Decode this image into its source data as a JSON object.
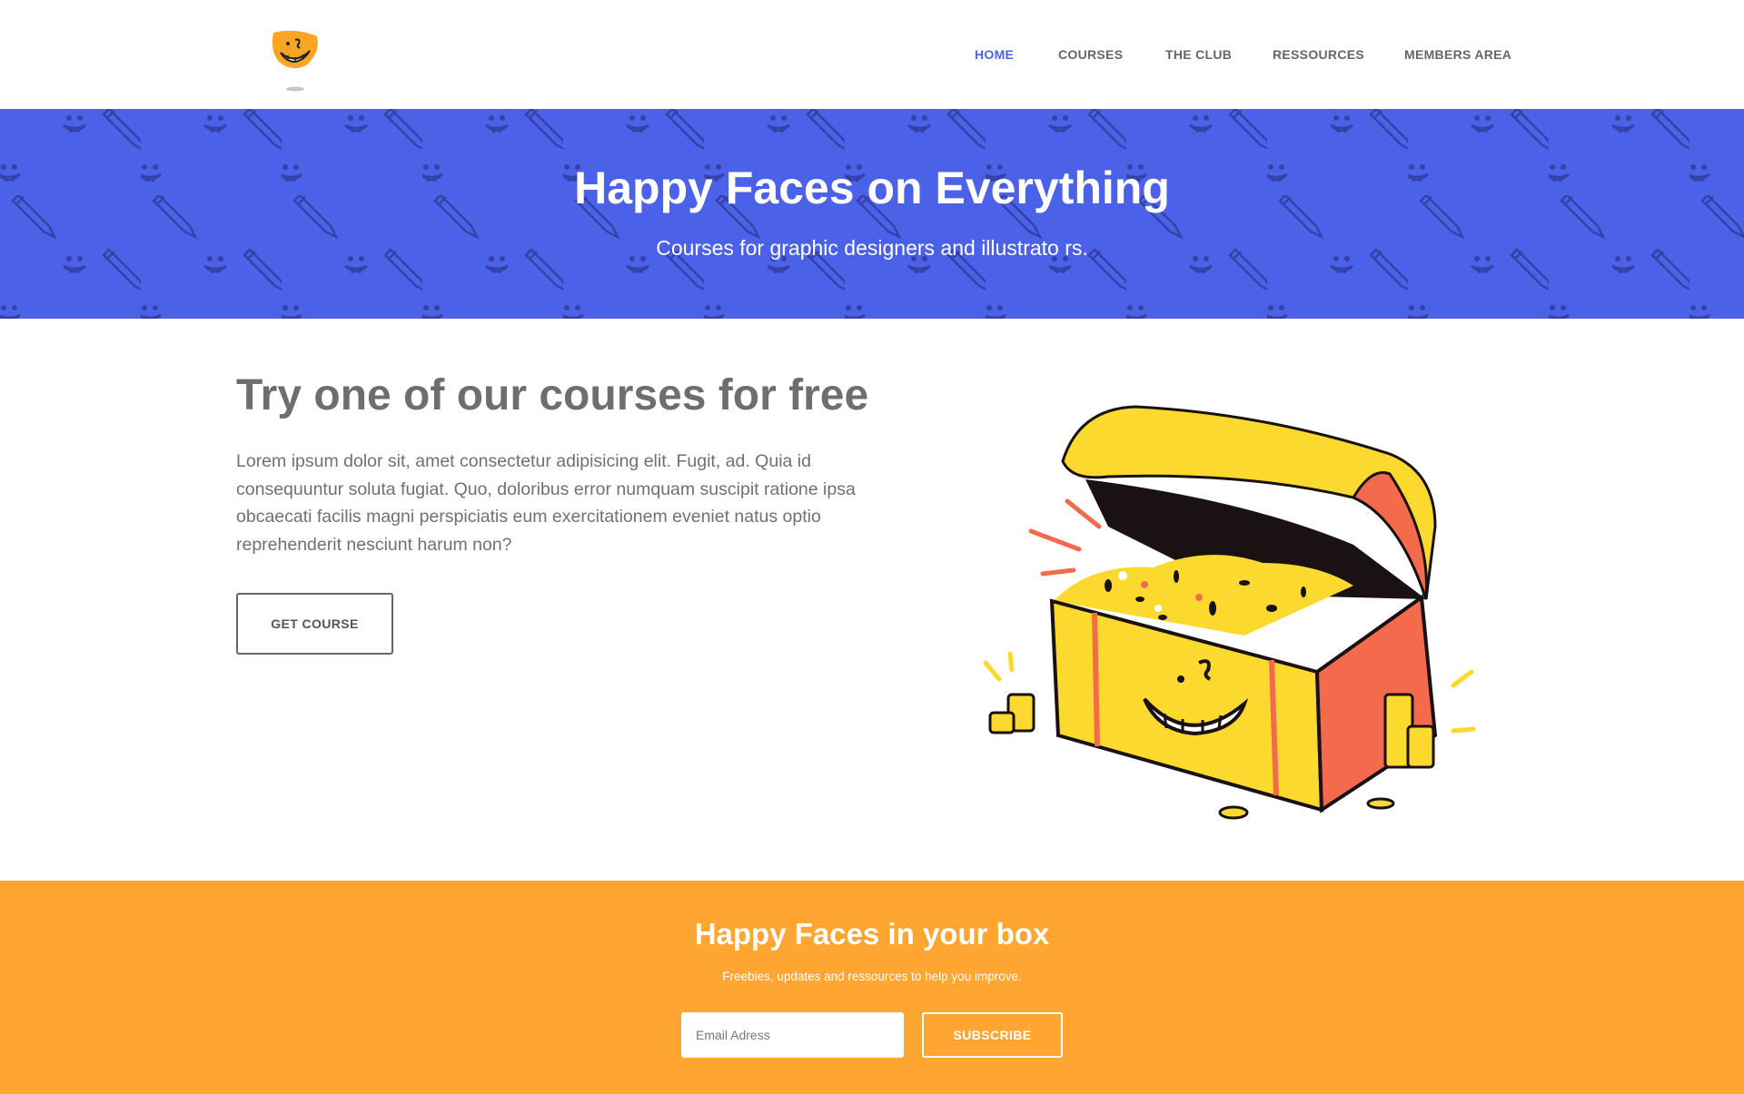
{
  "header": {
    "logo_name": "happy-face-logo",
    "nav": [
      {
        "label": "HOME",
        "active": true
      },
      {
        "label": "COURSES",
        "active": false
      },
      {
        "label": "THE CLUB",
        "active": false
      },
      {
        "label": "RESSOURCES",
        "active": false
      },
      {
        "label": "MEMBERS AREA",
        "active": false
      }
    ]
  },
  "hero": {
    "title": "Happy Faces on Everything",
    "subtitle": "Courses for graphic designers and illustrato rs."
  },
  "main": {
    "title": "Try one of our courses for free",
    "body": "Lorem ipsum dolor sit, amet consectetur adipisicing elit. Fugit, ad. Quia id consequuntur soluta fugiat. Quo, doloribus error numquam suscipit ratione ipsa obcaecati facilis magni perspiciatis eum exercitationem eveniet natus optio reprehenderit nesciunt harum non?",
    "button_label": "GET COURSE",
    "illustration": "treasure-chest-illustration"
  },
  "newsletter": {
    "title": "Happy Faces in your box",
    "subtitle": "Freebies, updates and ressources to help you improve.",
    "email_placeholder": "Email Adress",
    "subscribe_label": "SUBSCRIBE"
  },
  "colors": {
    "accent_blue": "#4b61e8",
    "nav_active": "#4a63e8",
    "orange": "#fea532",
    "chest_yellow": "#fcd92e",
    "chest_red": "#f36b4c",
    "text_gray": "#6e6e6e"
  }
}
